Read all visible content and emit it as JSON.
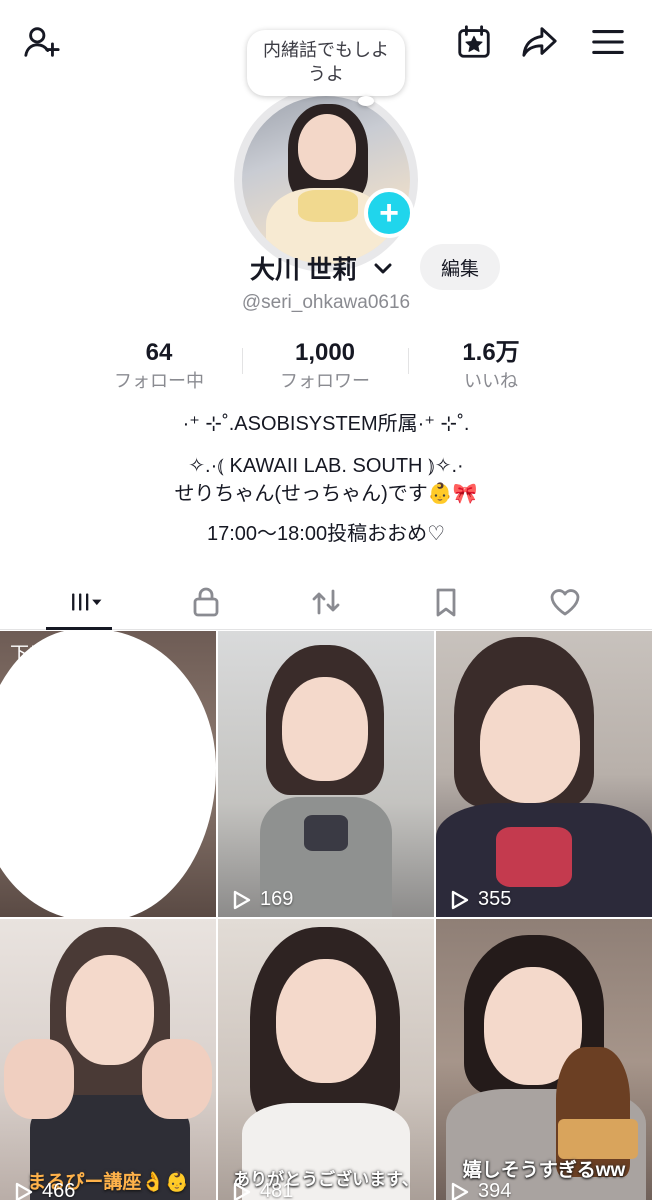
{
  "header": {
    "add_friend_icon": "person-plus-icon",
    "calendar_icon": "calendar-star-icon",
    "share_icon": "share-arrow-icon",
    "menu_icon": "hamburger-menu-icon"
  },
  "profile": {
    "note_bubble": "内緒話でもしようよ",
    "name": "大川 世莉",
    "edit_label": "編集",
    "handle": "@seri_ohkawa0616"
  },
  "stats": [
    {
      "value": "64",
      "label": "フォロー中"
    },
    {
      "value": "1,000",
      "label": "フォロワー"
    },
    {
      "value": "1.6万",
      "label": "いいね"
    }
  ],
  "bio": {
    "line1": "·⁺ ⊹˚.ASOBISYSTEM所属·⁺ ⊹˚.",
    "line2": "✧.·⦅ KAWAII LAB. SOUTH ⦆✧.·",
    "line3": "せりちゃん(せっちゃん)です👶🎀",
    "line4": "17:00〜18:00投稿おおめ♡"
  },
  "tabs": [
    {
      "name": "videos",
      "icon": "grid-bars-icon",
      "active": true
    },
    {
      "name": "private",
      "icon": "lock-icon",
      "active": false
    },
    {
      "name": "reposts",
      "icon": "repost-icon",
      "active": false
    },
    {
      "name": "favorites",
      "icon": "bookmark-icon",
      "active": false
    },
    {
      "name": "liked",
      "icon": "heart-icon",
      "active": false
    }
  ],
  "videos": [
    {
      "draft_label": "下書き",
      "views": ""
    },
    {
      "views": "169",
      "caption": ""
    },
    {
      "views": "355",
      "caption": ""
    },
    {
      "views": "466",
      "caption": "まるぴー講座👌👶"
    },
    {
      "views": "481",
      "caption": "ありがとうございます、"
    },
    {
      "views": "394",
      "caption": "嬉しそうすぎるww"
    }
  ],
  "colors": {
    "accent_cyan": "#20d5ec",
    "text_primary": "#161823",
    "text_secondary": "#8a8b91"
  }
}
